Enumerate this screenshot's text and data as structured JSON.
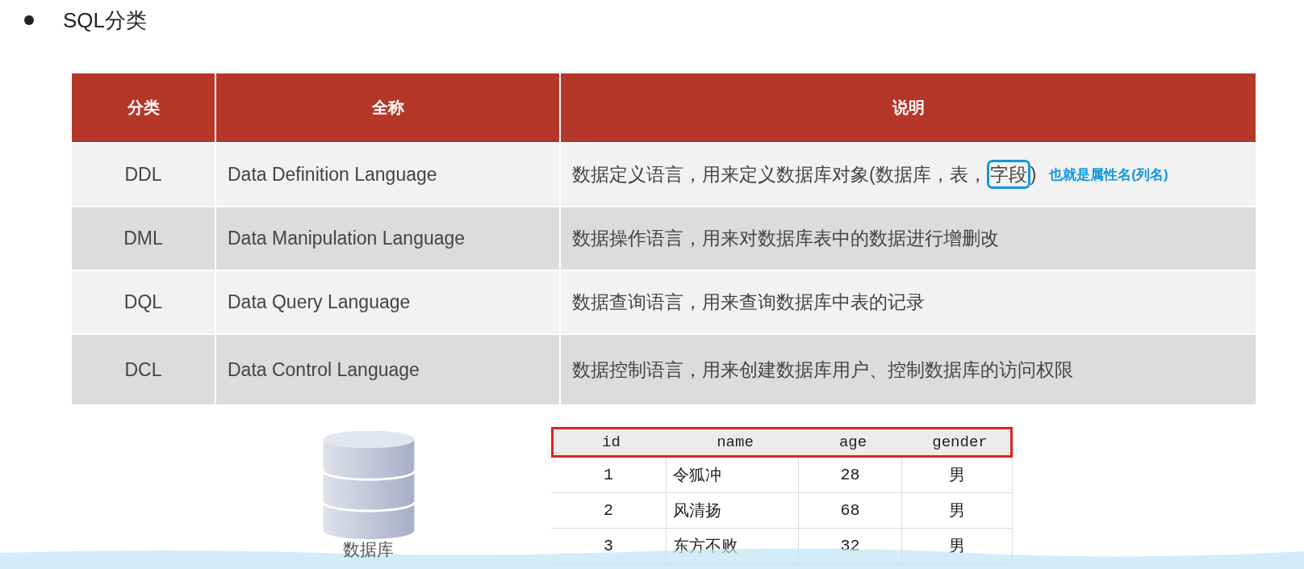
{
  "title": "SQL分类",
  "table": {
    "columns": [
      "分类",
      "全称",
      "说明"
    ],
    "rows": [
      {
        "code": "DDL",
        "full_name": "Data Definition Language",
        "description": [
          {
            "text": "数据定义语言，用来定义数据库对象(数据库，表，",
            "circled": false
          },
          {
            "text": "字段",
            "circled": true
          },
          {
            "text": ")",
            "circled": false
          }
        ],
        "note": "也就是属性名(列名)"
      },
      {
        "code": "DML",
        "full_name": "Data Manipulation Language",
        "description": [
          {
            "text": "数据操作语言，用来对数据库表中的数据进行增删改",
            "circled": false
          }
        ]
      },
      {
        "code": "DQL",
        "full_name": "Data Query Language",
        "description": [
          {
            "text": "数据查询语言，用来查询数据库中表的记录",
            "circled": false
          }
        ]
      },
      {
        "code": "DCL",
        "full_name": "Data Control Language",
        "description": [
          {
            "text": "数据控制语言，用来创建数据库用户、控制数据库的访问权限",
            "circled": false
          }
        ]
      }
    ]
  },
  "database_label": "数据库",
  "example_table": {
    "columns": [
      "id",
      "name",
      "age",
      "gender"
    ],
    "header_outlined": true,
    "rows": [
      [
        "1",
        "令狐冲",
        "28",
        "男"
      ],
      [
        "2",
        "风清扬",
        "68",
        "男"
      ],
      [
        "3",
        "东方不败",
        "32",
        "男"
      ]
    ]
  }
}
